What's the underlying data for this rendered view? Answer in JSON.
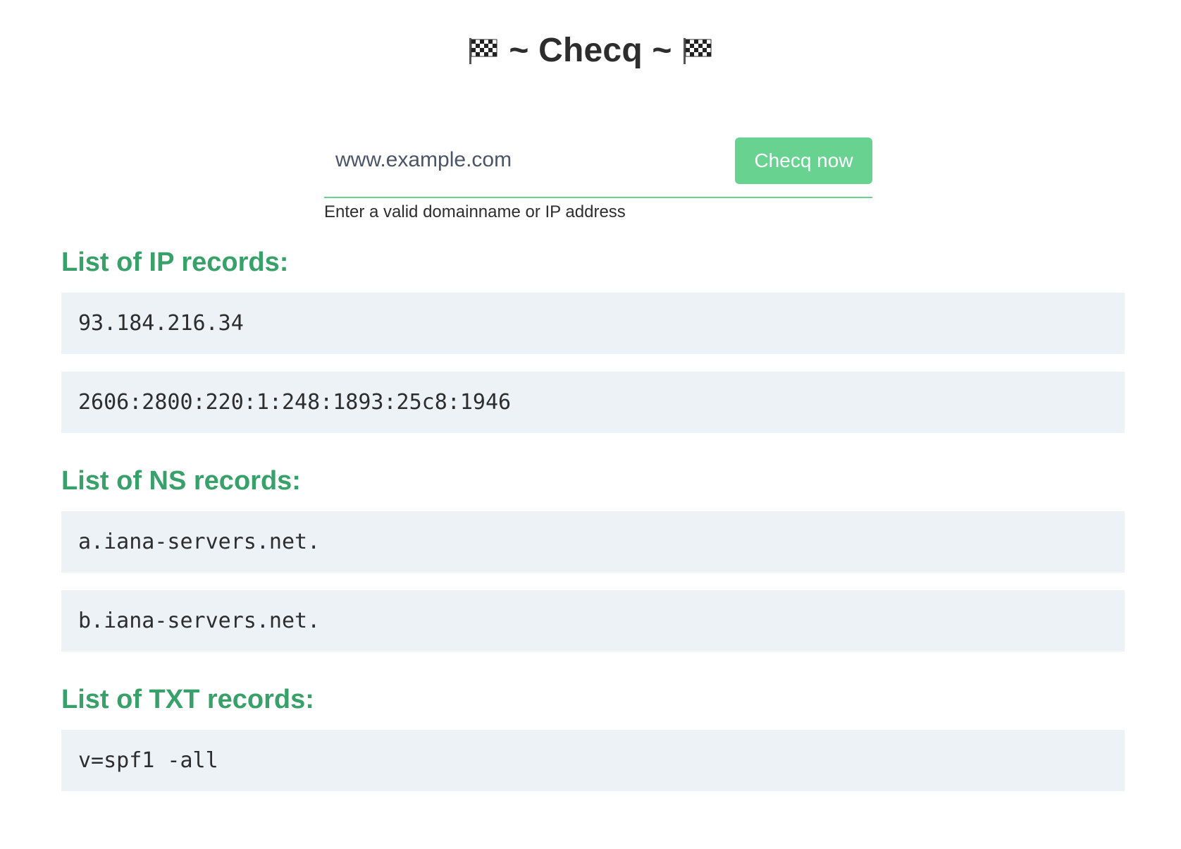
{
  "header": {
    "left_icon": "checkered-flag",
    "title": "~ Checq ~",
    "right_icon": "checkered-flag"
  },
  "search": {
    "placeholder": "www.example.com",
    "button_label": "Checq now",
    "hint": "Enter a valid domainname or IP address"
  },
  "colors": {
    "accent": "#68d391",
    "heading": "#38a169",
    "record_bg": "#edf2f7",
    "text": "#2d2d2d"
  },
  "sections": [
    {
      "title": "List of IP records:",
      "records": [
        "93.184.216.34",
        "2606:2800:220:1:248:1893:25c8:1946"
      ]
    },
    {
      "title": "List of NS records:",
      "records": [
        "a.iana-servers.net.",
        "b.iana-servers.net."
      ]
    },
    {
      "title": "List of TXT records:",
      "records": [
        "v=spf1 -all"
      ]
    }
  ]
}
